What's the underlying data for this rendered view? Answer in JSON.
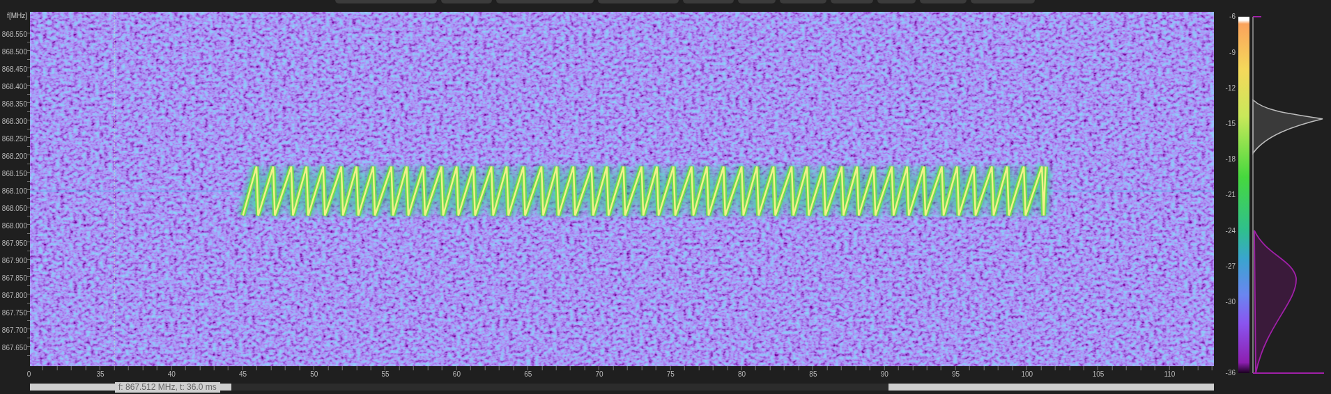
{
  "frequency_axis": {
    "unit_label": "f[MHz]",
    "ticks": [
      "868.550",
      "868.500",
      "868.450",
      "868.400",
      "868.350",
      "868.300",
      "868.250",
      "868.200",
      "868.150",
      "868.100",
      "868.050",
      "868.000",
      "867.950",
      "867.900",
      "867.850",
      "867.800",
      "867.750",
      "867.700",
      "867.650"
    ]
  },
  "time_axis": {
    "ticks": [
      "0",
      "35",
      "40",
      "45",
      "50",
      "55",
      "60",
      "65",
      "70",
      "75",
      "80",
      "85",
      "90",
      "95",
      "100",
      "105",
      "110"
    ]
  },
  "colorbar": {
    "ticks": [
      "-6",
      "-9",
      "-12",
      "-15",
      "-18",
      "-21",
      "-24",
      "-27",
      "-30",
      "-36"
    ]
  },
  "cursor_readout": "f: 867.512 MHz, t: 36.0 ms"
}
